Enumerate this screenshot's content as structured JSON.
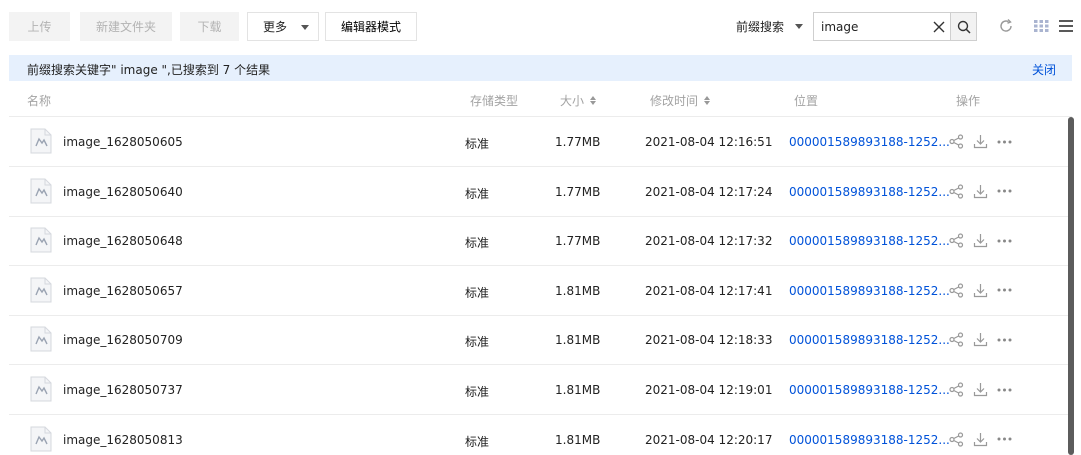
{
  "toolbar": {
    "upload": "上传",
    "new_folder": "新建文件夹",
    "download": "下载",
    "more": "更多",
    "editor_mode": "编辑器模式",
    "prefix_search": "前缀搜索",
    "search_value": "image"
  },
  "banner": {
    "message": "前缀搜索关键字\" image \",已搜索到 7 个结果",
    "close": "关闭"
  },
  "table": {
    "headers": {
      "name": "名称",
      "storage": "存储类型",
      "size": "大小",
      "modified": "修改时间",
      "location": "位置",
      "actions": "操作"
    },
    "rows": [
      {
        "name": "image_1628050605",
        "storage": "标准",
        "size": "1.77MB",
        "modified": "2021-08-04 12:16:51",
        "location": "000001589893188-1252..."
      },
      {
        "name": "image_1628050640",
        "storage": "标准",
        "size": "1.77MB",
        "modified": "2021-08-04 12:17:24",
        "location": "000001589893188-1252..."
      },
      {
        "name": "image_1628050648",
        "storage": "标准",
        "size": "1.77MB",
        "modified": "2021-08-04 12:17:32",
        "location": "000001589893188-1252..."
      },
      {
        "name": "image_1628050657",
        "storage": "标准",
        "size": "1.81MB",
        "modified": "2021-08-04 12:17:41",
        "location": "000001589893188-1252..."
      },
      {
        "name": "image_1628050709",
        "storage": "标准",
        "size": "1.81MB",
        "modified": "2021-08-04 12:18:33",
        "location": "000001589893188-1252..."
      },
      {
        "name": "image_1628050737",
        "storage": "标准",
        "size": "1.81MB",
        "modified": "2021-08-04 12:19:01",
        "location": "000001589893188-1252..."
      },
      {
        "name": "image_1628050813",
        "storage": "标准",
        "size": "1.81MB",
        "modified": "2021-08-04 12:20:17",
        "location": "000001589893188-1252..."
      }
    ]
  },
  "icons": {
    "file": "image-file-icon",
    "share": "share-icon",
    "download": "download-icon",
    "more": "more-icon"
  },
  "colors": {
    "link": "#0052d9",
    "banner_bg": "#e6f0fd",
    "disabled_bg": "#f3f3f3"
  }
}
